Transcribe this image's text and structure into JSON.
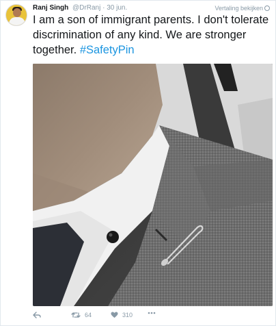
{
  "tweet": {
    "author_name": "Ranj Singh",
    "author_handle": "@DrRanj",
    "separator": "·",
    "date": "30 jun.",
    "translate_label": "Vertaling bekijken",
    "text_main": "I am a son of immigrant parents. I don't tolerate discrimination of any kind. We are stronger together. ",
    "hashtag": "#SafetyPin",
    "photo_alt": "Close-up of a man's jacket lapel with a safety pin",
    "actions": {
      "reply_icon": "reply-icon",
      "retweet_icon": "retweet-icon",
      "retweet_count": "64",
      "like_icon": "heart-icon",
      "like_count": "310",
      "more_icon": "more-icon"
    }
  },
  "colors": {
    "text": "#14171a",
    "muted": "#8899a6",
    "link": "#1b95e0",
    "border": "#e1e8ed"
  }
}
